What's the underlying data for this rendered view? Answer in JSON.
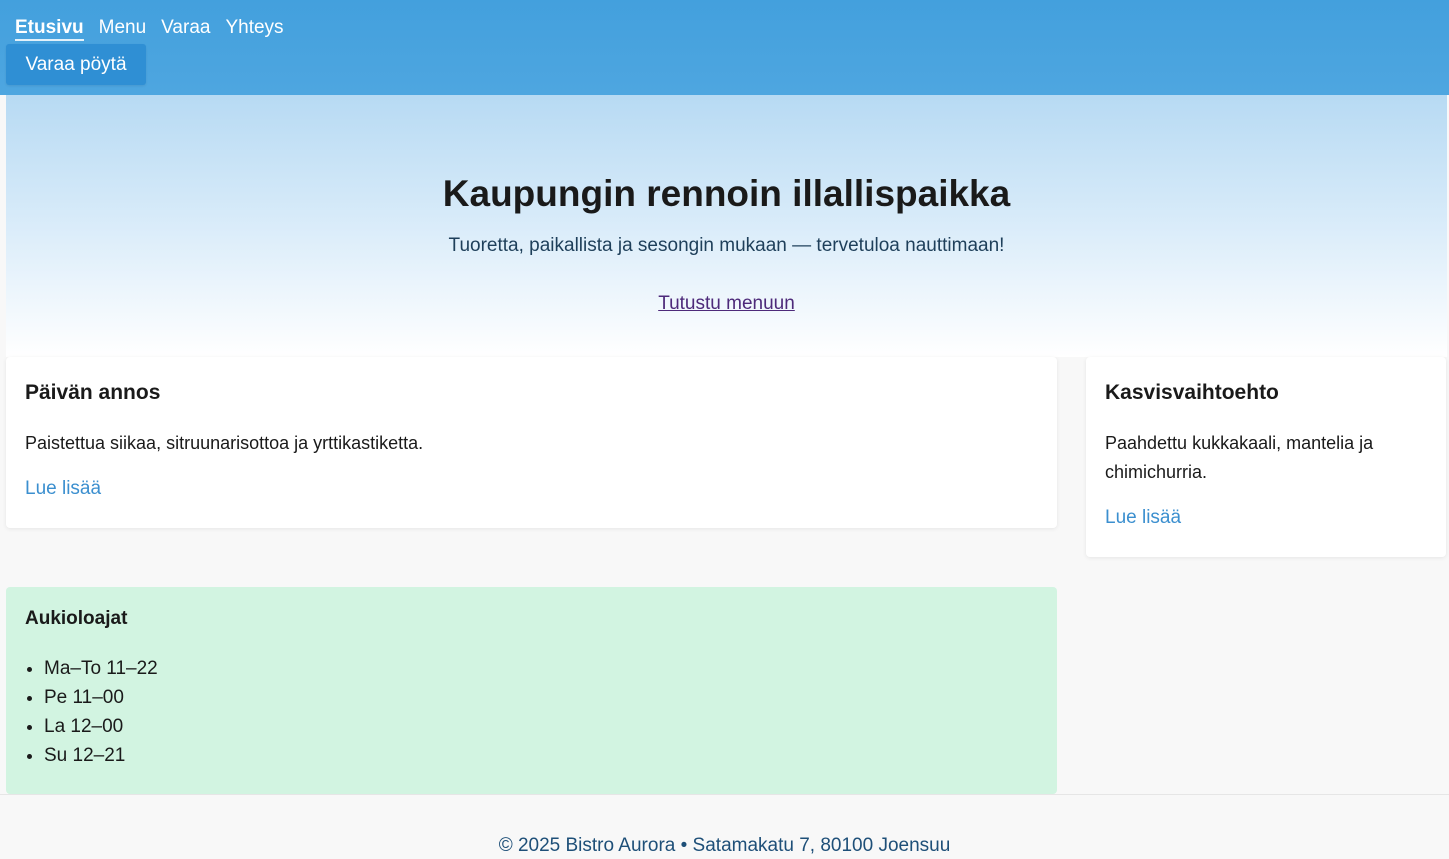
{
  "nav": {
    "items": [
      {
        "label": "Etusivu",
        "active": true
      },
      {
        "label": "Menu"
      },
      {
        "label": "Varaa"
      },
      {
        "label": "Yhteys"
      }
    ],
    "book_button": "Varaa pöytä"
  },
  "hero": {
    "title": "Kaupungin rennoin illallispaikka",
    "subtitle": "Tuoretta, paikallista ja sesongin mukaan — tervetuloa nauttimaan!",
    "link": "Tutustu menuun"
  },
  "cards": [
    {
      "title": "Päivän annos",
      "text": "Paistettua siikaa, sitruunarisottoa ja yrttikastiketta.",
      "link": "Lue lisää"
    },
    {
      "title": "Kasvisvaihtoehto",
      "text": "Paahdettu kukkakaali, mantelia ja chimichurria.",
      "link": "Lue lisää"
    }
  ],
  "hours": {
    "title": "Aukioloajat",
    "items": [
      "Ma–To 11–22",
      "Pe 11–00",
      "La 12–00",
      "Su 12–21"
    ]
  },
  "footer": {
    "text": "© 2025 Bistro Aurora • Satamakatu 7, 80100 Joensuu"
  },
  "colors": {
    "header": "#43a0dd",
    "button": "#2f8fd4",
    "link": "#3b8fcf",
    "hours_bg": "#d2f4e1"
  }
}
